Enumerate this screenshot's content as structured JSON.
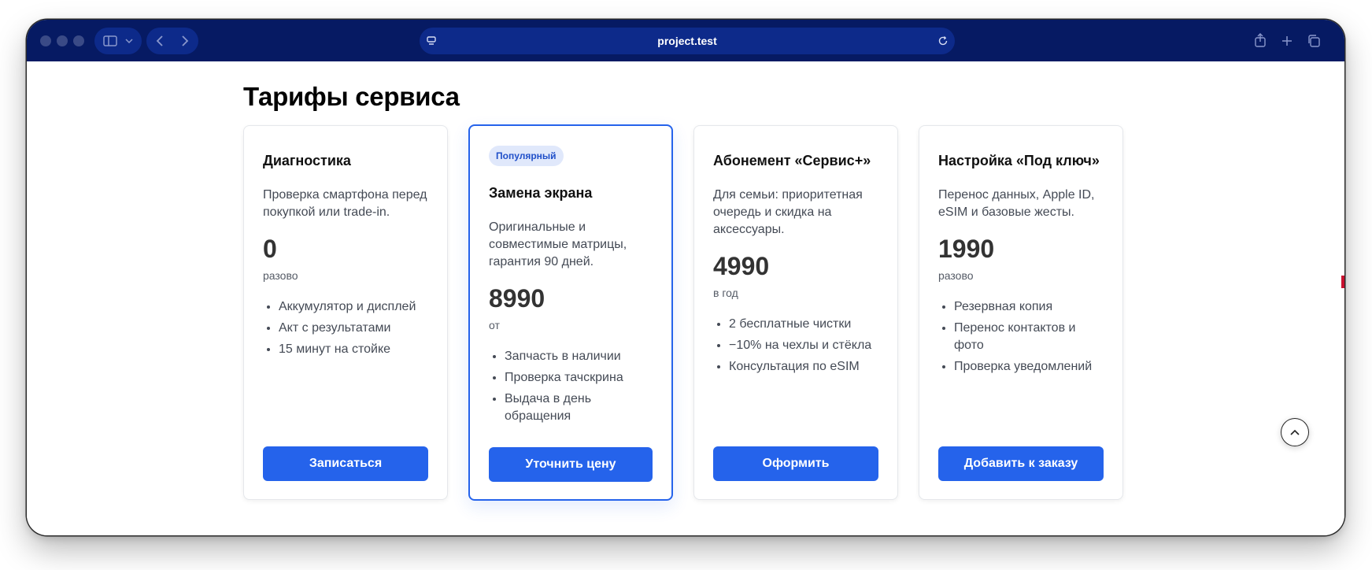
{
  "browser": {
    "address": "project.test"
  },
  "page": {
    "title": "Тарифы сервиса"
  },
  "cards": [
    {
      "title": "Диагностика",
      "description": "Проверка смартфона перед покупкой или trade-in.",
      "price": "0",
      "period": "разово",
      "features": [
        "Аккумулятор и дисплей",
        "Акт с результатами",
        "15 минут на стойке"
      ],
      "cta": "Записаться"
    },
    {
      "badge": "Популярный",
      "title": "Замена экрана",
      "description": "Оригинальные и совместимые матрицы, гарантия 90 дней.",
      "price": "8990",
      "period": "от",
      "features": [
        "Запчасть в наличии",
        "Проверка тачскрина",
        "Выдача в день обращения"
      ],
      "cta": "Уточнить цену"
    },
    {
      "title": "Абонемент «Сервис+»",
      "description": "Для семьи: приоритетная очередь и скидка на аксессуары.",
      "price": "4990",
      "period": "в год",
      "features": [
        "2 бесплатные чистки",
        "−10% на чехлы и стёкла",
        "Консультация по eSIM"
      ],
      "cta": "Оформить"
    },
    {
      "title": "Настройка «Под ключ»",
      "description": "Перенос данных, Apple ID, eSIM и базовые жесты.",
      "price": "1990",
      "period": "разово",
      "features": [
        "Резервная копия",
        "Перенос контактов и фото",
        "Проверка уведомлений"
      ],
      "cta": "Добавить к заказу"
    }
  ],
  "colors": {
    "titlebar": "#061a63",
    "accent": "#2563eb",
    "badge_bg": "#e0e8fb"
  },
  "icons": {
    "sidebar": "sidebar-icon",
    "back": "chevron-left-icon",
    "forward": "chevron-right-icon",
    "reload": "reload-icon",
    "share": "share-icon",
    "new_tab": "plus-icon",
    "tabs": "tabs-overview-icon",
    "scroll_top": "chevron-up-icon"
  }
}
